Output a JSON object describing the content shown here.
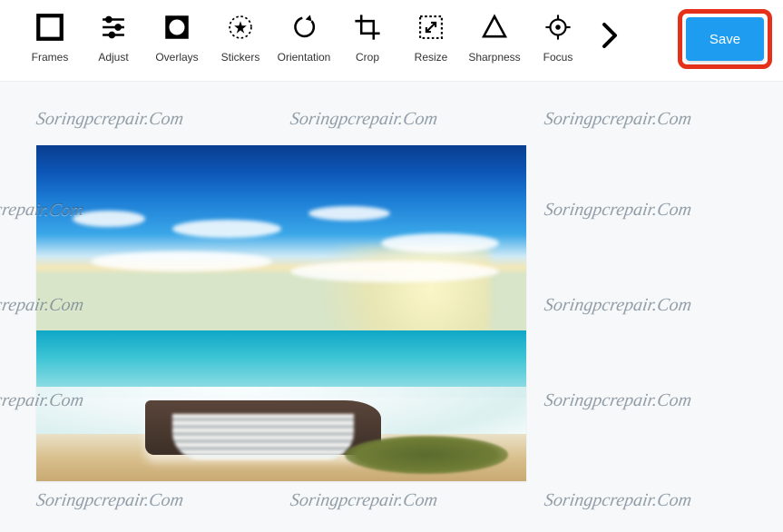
{
  "toolbar": {
    "tools": [
      {
        "id": "frames",
        "label": "Frames",
        "icon": "frames-icon"
      },
      {
        "id": "adjust",
        "label": "Adjust",
        "icon": "adjust-icon"
      },
      {
        "id": "overlays",
        "label": "Overlays",
        "icon": "overlays-icon"
      },
      {
        "id": "stickers",
        "label": "Stickers",
        "icon": "stickers-icon"
      },
      {
        "id": "orientation",
        "label": "Orientation",
        "icon": "orientation-icon"
      },
      {
        "id": "crop",
        "label": "Crop",
        "icon": "crop-icon"
      },
      {
        "id": "resize",
        "label": "Resize",
        "icon": "resize-icon"
      },
      {
        "id": "sharpness",
        "label": "Sharpness",
        "icon": "sharpness-icon"
      },
      {
        "id": "focus",
        "label": "Focus",
        "icon": "focus-icon"
      }
    ],
    "next_icon": "chevron-right-icon",
    "save_label": "Save"
  },
  "watermark": {
    "text": "Soringpcrepair.Com"
  },
  "canvas": {
    "image_description": "Beach landscape with blue sky, clouds, turquoise sea, small waterfall over rock ledge and sandy shore"
  },
  "colors": {
    "accent": "#1e9df0",
    "highlight_border": "#e53119"
  }
}
